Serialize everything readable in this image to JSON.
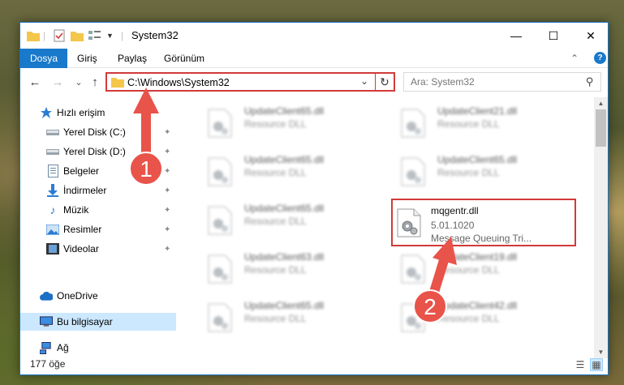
{
  "window": {
    "title": "System32",
    "controls": {
      "minimize": "—",
      "maximize": "☐",
      "close": "✕"
    }
  },
  "ribbon": {
    "tabs": [
      "Dosya",
      "Giriş",
      "Paylaş",
      "Görünüm"
    ],
    "collapse": "⌃",
    "help": "?"
  },
  "nav": {
    "back": "←",
    "forward": "→",
    "recent": "⌄",
    "up": "↑",
    "address": "C:\\Windows\\System32",
    "dropdown": "⌄",
    "refresh": "↻",
    "search_placeholder": "Ara: System32",
    "search_icon": "⚲"
  },
  "sidebar": {
    "items": [
      {
        "label": "Hızlı erişim",
        "icon": "star-icon",
        "pinned": false
      },
      {
        "label": "Yerel Disk (C:)",
        "icon": "drive-icon",
        "pinned": true
      },
      {
        "label": "Yerel Disk (D:)",
        "icon": "drive-icon",
        "pinned": true
      },
      {
        "label": "Belgeler",
        "icon": "documents-icon",
        "pinned": true
      },
      {
        "label": "İndirmeler",
        "icon": "downloads-icon",
        "pinned": true
      },
      {
        "label": "Müzik",
        "icon": "music-icon",
        "pinned": true
      },
      {
        "label": "Resimler",
        "icon": "pictures-icon",
        "pinned": true
      },
      {
        "label": "Videolar",
        "icon": "videos-icon",
        "pinned": true
      },
      {
        "label": "OneDrive",
        "icon": "cloud-icon",
        "pinned": false
      },
      {
        "label": "Bu bilgisayar",
        "icon": "computer-icon",
        "pinned": false
      },
      {
        "label": "Ağ",
        "icon": "network-icon",
        "pinned": false
      }
    ],
    "pin_glyph": "📌"
  },
  "files": [
    {
      "name": "UpdateClient65.dll",
      "desc": "Resource DLL"
    },
    {
      "name": "UpdateClient21.dll",
      "desc": "Resource DLL"
    },
    {
      "name": "UpdateClient65.dll",
      "desc": "Resource DLL"
    },
    {
      "name": "UpdateClient65.dll",
      "desc": "Resource DLL"
    },
    {
      "name": "UpdateClient65.dll",
      "desc": "Resource DLL"
    },
    {
      "name": "mqgentr.dll",
      "version": "5.01.1020",
      "desc": "Message Queuing Tri..."
    },
    {
      "name": "UpdateClient63.dll",
      "desc": "Resource DLL"
    },
    {
      "name": "UpdateClient19.dll",
      "desc": "Resource DLL"
    },
    {
      "name": "UpdateClient65.dll",
      "desc": "Resource DLL"
    },
    {
      "name": "UpdateClient42.dll",
      "desc": "Resource DLL"
    }
  ],
  "status": {
    "count": "177 öğe"
  },
  "annotations": {
    "step1": "1",
    "step2": "2",
    "color": "#e8534a"
  }
}
